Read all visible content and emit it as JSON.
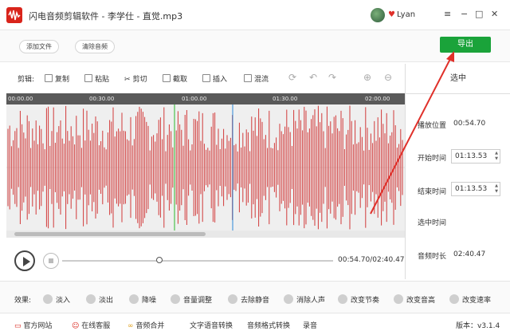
{
  "app": {
    "title": "闪电音频剪辑软件 - 李学仕 - 直觉.mp3",
    "user_name": "Lyan",
    "colors": {
      "brand_red": "#d9241b",
      "accent_green": "#1aa33a",
      "waveform": "#d23a3a"
    }
  },
  "window_controls": {
    "menu": "≡",
    "minimize": "−",
    "maximize": "□",
    "close": "✕"
  },
  "toolbar": {
    "add_file": "添加文件",
    "clear_audio": "清除音频",
    "export": "导出"
  },
  "edit_tools": {
    "label": "剪辑:",
    "items": [
      {
        "label": "复制",
        "icon": "copy-icon"
      },
      {
        "label": "粘贴",
        "icon": "paste-icon"
      },
      {
        "label": "剪切",
        "icon": "scissors-icon"
      },
      {
        "label": "截取",
        "icon": "crop-icon"
      },
      {
        "label": "插入",
        "icon": "insert-icon"
      },
      {
        "label": "混流",
        "icon": "mix-icon"
      }
    ],
    "extra_icons": [
      "loop-icon",
      "undo-icon",
      "redo-icon",
      "zoom-in-icon",
      "zoom-out-icon"
    ]
  },
  "timeline": {
    "ticks": [
      "00:00.00",
      "00:30.00",
      "01:00.00",
      "01:30.00",
      "02:00.00"
    ]
  },
  "right_panel": {
    "header": "选中",
    "play_position_label": "播放位置",
    "play_position": "00:54.70",
    "start_time_label": "开始时间",
    "start_time": "01:13.53",
    "end_time_label": "结束时间",
    "end_time": "01:13.53",
    "selected_time_label": "选中时间",
    "selected_time": "",
    "duration_label": "音频时长",
    "duration": "02:40.47"
  },
  "player": {
    "time_readout": "00:54.70/02:40.47",
    "progress_fraction": 0.34
  },
  "effects": {
    "label": "效果:",
    "items": [
      {
        "label": "淡入",
        "icon": "fade-in-icon"
      },
      {
        "label": "淡出",
        "icon": "fade-out-icon"
      },
      {
        "label": "降噪",
        "icon": "denoise-icon"
      },
      {
        "label": "音量调整",
        "icon": "volume-icon"
      },
      {
        "label": "去除静音",
        "icon": "remove-silence-icon"
      },
      {
        "label": "消除人声",
        "icon": "remove-vocal-icon"
      },
      {
        "label": "改变节奏",
        "icon": "tempo-icon"
      },
      {
        "label": "改变音高",
        "icon": "pitch-icon"
      },
      {
        "label": "改变速率",
        "icon": "speed-icon"
      }
    ]
  },
  "footer": {
    "website": "官方网站",
    "support": "在线客服",
    "merge": "音频合并",
    "tts": "文字语音转换",
    "format": "音频格式转换",
    "record": "录音",
    "version": "版本：v3.1.4"
  }
}
